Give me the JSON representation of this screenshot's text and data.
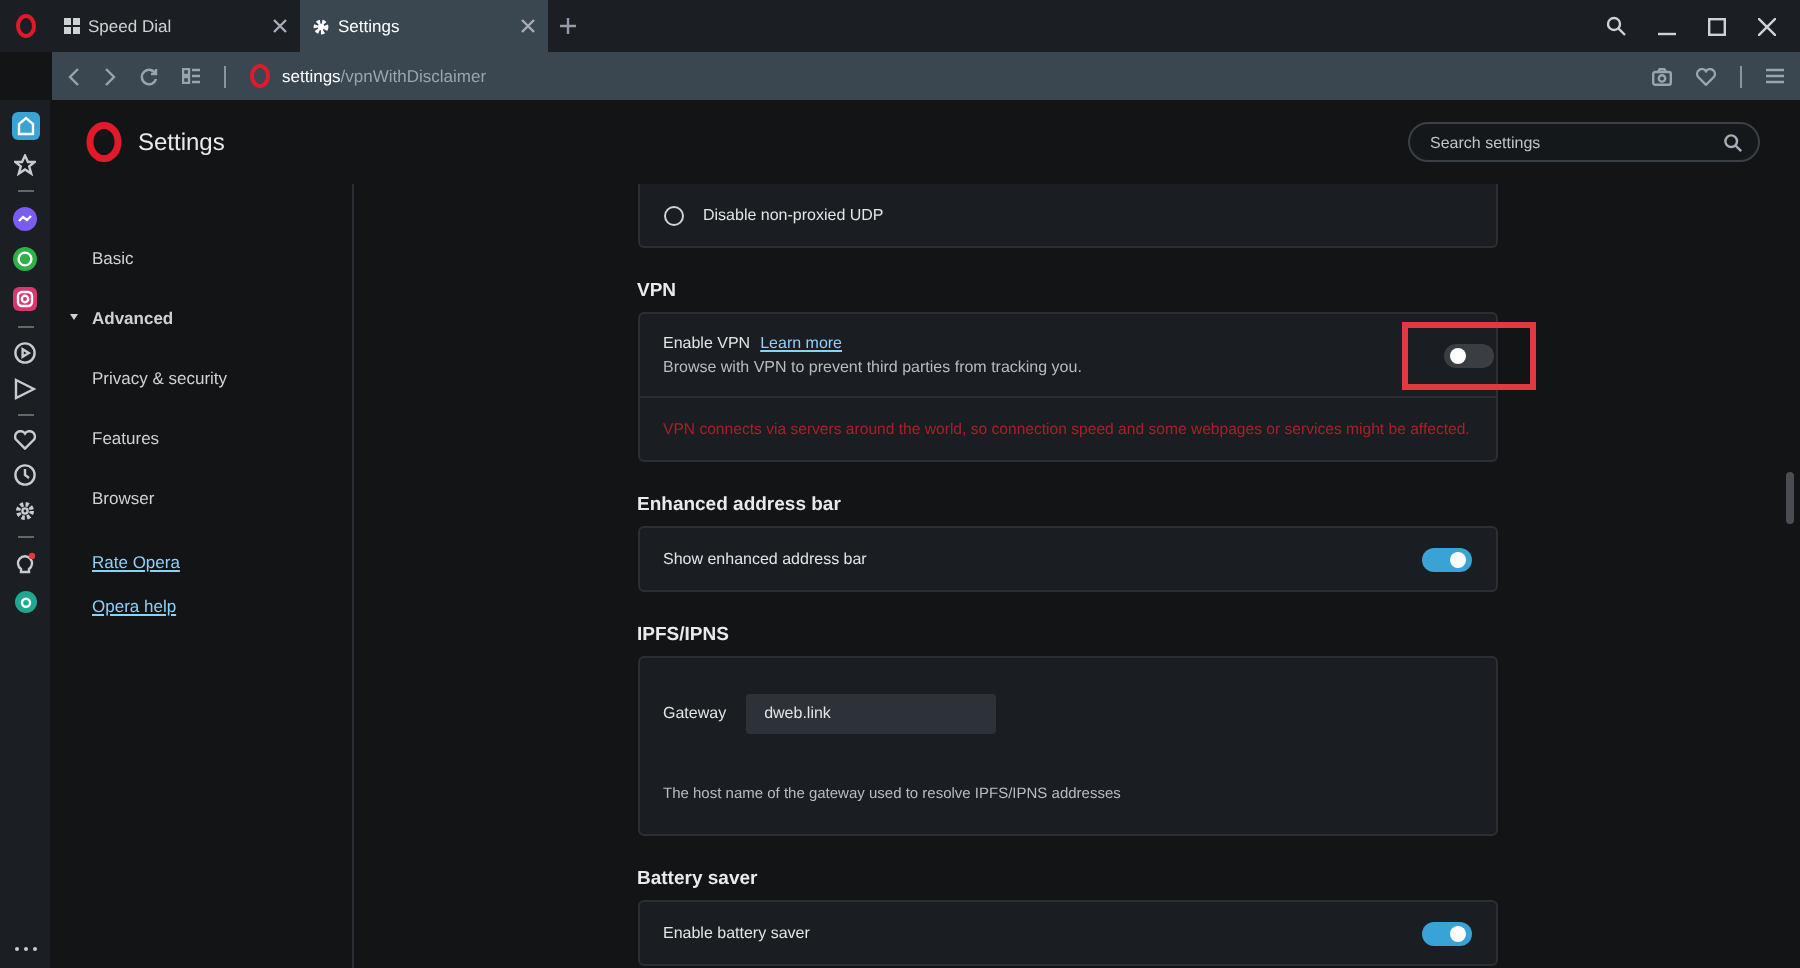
{
  "tabs": [
    {
      "kind": "speed-dial",
      "label": "Speed Dial",
      "selected": false
    },
    {
      "kind": "settings",
      "label": "Settings",
      "selected": true
    }
  ],
  "address_bar": {
    "host": "settings",
    "path": "/vpnWithDisclaimer"
  },
  "header": {
    "title": "Settings",
    "search": {
      "placeholder": "Search settings"
    }
  },
  "nav": {
    "items": [
      {
        "label": "Basic",
        "kind": "item"
      },
      {
        "label": "Advanced",
        "kind": "group",
        "expanded": true
      },
      {
        "label": "Privacy & security",
        "kind": "item"
      },
      {
        "label": "Features",
        "kind": "item"
      },
      {
        "label": "Browser",
        "kind": "item"
      }
    ],
    "links": [
      "Rate Opera",
      "Opera help"
    ]
  },
  "sections": [
    {
      "rows": [
        {
          "kind": "radio",
          "label": "Disable non-proxied UDP",
          "selected": false
        }
      ]
    },
    {
      "title": "VPN",
      "rows": [
        {
          "kind": "toggle",
          "label": "Enable VPN",
          "link": "Learn more",
          "description": "Browse with VPN to prevent third parties from tracking you.",
          "on": false,
          "highlighted": true
        },
        {
          "kind": "warning",
          "text": "VPN connects via servers around the world, so connection speed and some webpages or services might be affected."
        }
      ]
    },
    {
      "title": "Enhanced address bar",
      "rows": [
        {
          "kind": "toggle",
          "label": "Show enhanced address bar",
          "on": true,
          "highlighted": false
        }
      ]
    },
    {
      "title": "IPFS/IPNS",
      "rows": [
        {
          "kind": "field",
          "label": "Gateway",
          "value": "dweb.link"
        },
        {
          "kind": "note",
          "text": "The host name of the gateway used to resolve IPFS/IPNS addresses"
        }
      ]
    },
    {
      "title": "Battery saver",
      "rows": [
        {
          "kind": "toggle",
          "label": "Enable battery saver",
          "on": true,
          "highlighted": false
        }
      ]
    }
  ]
}
